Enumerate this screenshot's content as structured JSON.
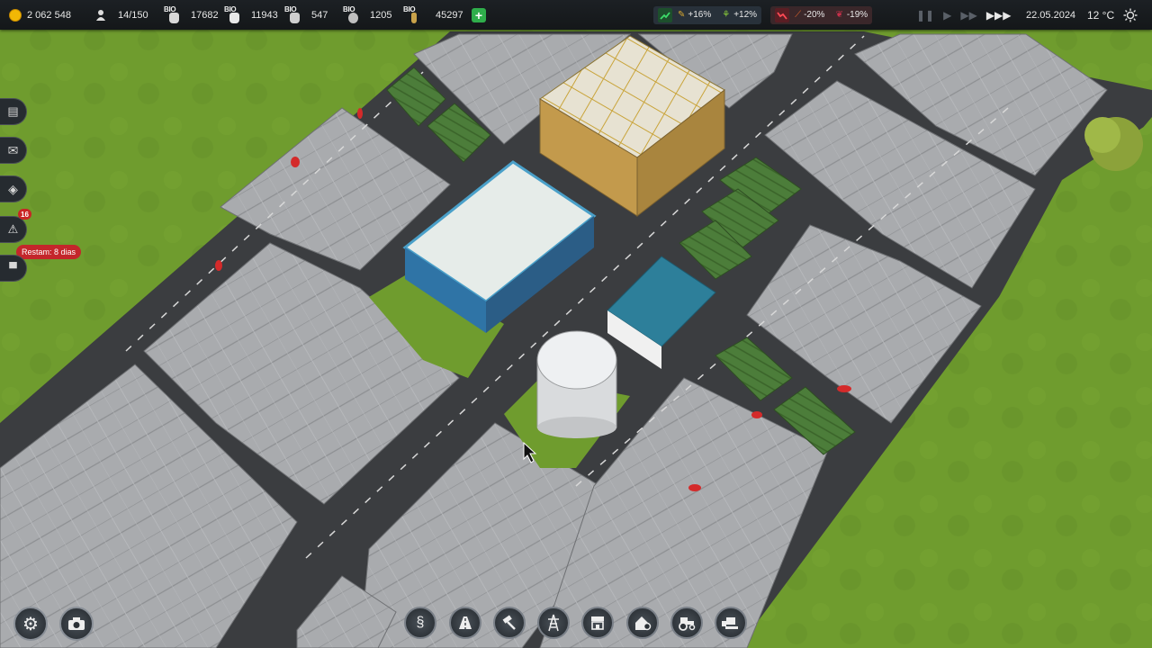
{
  "topbar": {
    "money": "2 062 548",
    "workers": "14/150",
    "resources": [
      {
        "tag": "BIO",
        "value": "17682",
        "icon": "bio-grain-sack-icon",
        "color": "#d8d8d8"
      },
      {
        "tag": "BIO",
        "value": "11943",
        "icon": "bio-flour-sack-icon",
        "color": "#e8e8e8"
      },
      {
        "tag": "BIO",
        "value": "547",
        "icon": "bio-seed-sack-icon",
        "color": "#cfcfcf"
      },
      {
        "tag": "BIO",
        "value": "1205",
        "icon": "bio-cauliflower-icon",
        "color": "#bfbfbf"
      },
      {
        "tag": "BIO",
        "value": "45297",
        "icon": "bio-wheat-icon",
        "color": "#c9a24a"
      }
    ],
    "trends": [
      {
        "value": "+16%",
        "kind": "up",
        "icon": "wheat-trend-icon"
      },
      {
        "value": "+12%",
        "kind": "up",
        "icon": "corn-trend-icon"
      },
      {
        "value": "-20%",
        "kind": "down",
        "icon": "carrot-trend-icon"
      },
      {
        "value": "-19%",
        "kind": "down",
        "icon": "beet-trend-icon"
      }
    ],
    "date": "22.05.2024",
    "temperature": "12 °C"
  },
  "sidebar": {
    "alerts_badge": "16",
    "notice": "Restam: 8 dias"
  },
  "colors": {
    "grass": "#6c9a2c",
    "road": "#3b3d40",
    "greenhouse": "#a6a8ab",
    "accent_green": "#2fae4b",
    "alert_red": "#c4262b"
  }
}
